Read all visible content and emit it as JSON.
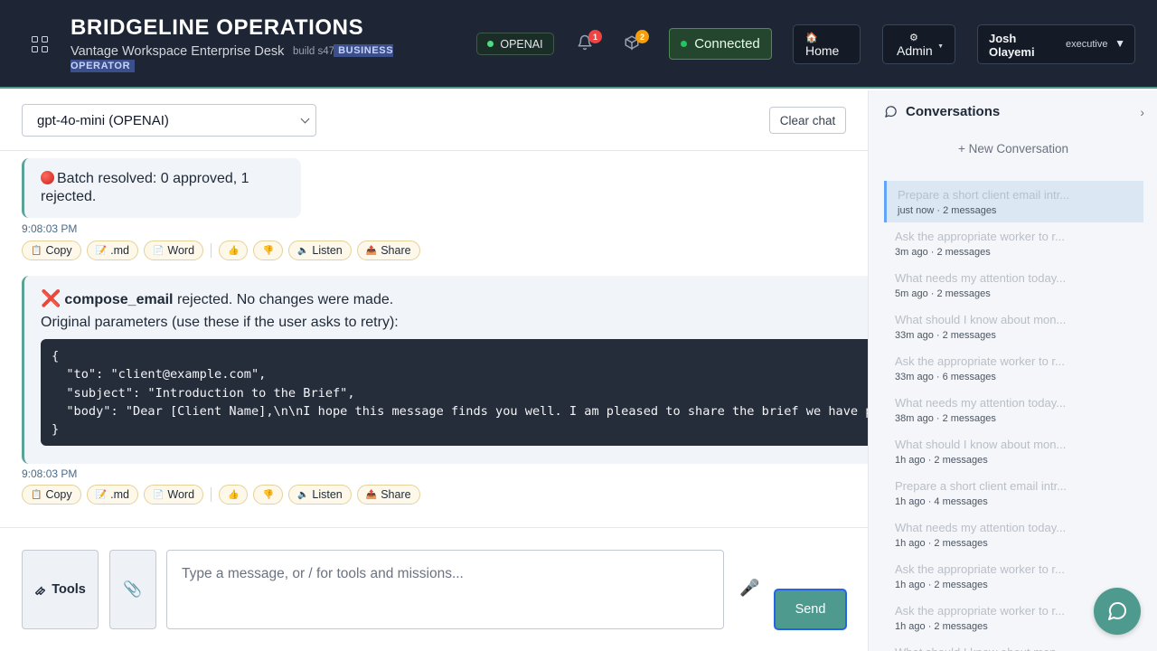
{
  "header": {
    "brand_title": "BRIDGELINE OPERATIONS",
    "brand_subtitle": "Vantage Workspace Enterprise Desk",
    "build": "build s475",
    "role_badge": "BUSINESS OPERATOR",
    "provider": "OPENAI",
    "notifications_count": "1",
    "packages_count": "2",
    "connection_status": "Connected",
    "home_label": "Home",
    "home_icon": "🏠",
    "admin_label": "Admin",
    "admin_icon": "⚙",
    "user_name": "Josh Olayemi",
    "user_role": "executive"
  },
  "toolbar": {
    "model_selected": "gpt-4o-mini (OPENAI)",
    "clear_label": "Clear chat"
  },
  "messages": [
    {
      "text": "Batch resolved: 0 approved, 1 rejected.",
      "time": "9:08:03 PM"
    },
    {
      "tool_name": "compose_email",
      "status_text": "rejected. No changes were made.",
      "params_intro": "Original parameters (use these if the user asks to retry):",
      "code": "{\n  \"to\": \"client@example.com\",\n  \"subject\": \"Introduction to the Brief\",\n  \"body\": \"Dear [Client Name],\\n\\nI hope this message finds you well. I am pleased to share the brief we have pr\n}",
      "time": "9:08:03 PM"
    }
  ],
  "message_actions": {
    "copy": "Copy",
    "md": ".md",
    "word": "Word",
    "like": "👍",
    "dislike": "👎",
    "listen": "Listen",
    "share": "Share"
  },
  "composer": {
    "tools_label": "Tools",
    "placeholder": "Type a message, or / for tools and missions...",
    "send_label": "Send"
  },
  "sidebar": {
    "title": "Conversations",
    "new_label": "+ New Conversation",
    "items": [
      {
        "title": "Prepare a short client email intr...",
        "meta": "just now · 2 messages",
        "active": true
      },
      {
        "title": "Ask the appropriate worker to r...",
        "meta": "3m ago · 2 messages"
      },
      {
        "title": "What needs my attention today...",
        "meta": "5m ago · 2 messages"
      },
      {
        "title": "What should I know about mon...",
        "meta": "33m ago · 2 messages"
      },
      {
        "title": "Ask the appropriate worker to r...",
        "meta": "33m ago · 6 messages"
      },
      {
        "title": "What needs my attention today...",
        "meta": "38m ago · 2 messages"
      },
      {
        "title": "What should I know about mon...",
        "meta": "1h ago · 2 messages"
      },
      {
        "title": "Prepare a short client email intr...",
        "meta": "1h ago · 4 messages"
      },
      {
        "title": "What needs my attention today...",
        "meta": "1h ago · 2 messages"
      },
      {
        "title": "Ask the appropriate worker to r...",
        "meta": "1h ago · 2 messages"
      },
      {
        "title": "Ask the appropriate worker to r...",
        "meta": "1h ago · 2 messages"
      },
      {
        "title": "What should I know about mon...",
        "meta": ""
      }
    ]
  },
  "colors": {
    "header_bg": "#1e2635",
    "accent_teal": "#4e9a8e",
    "connected_green": "#22c55e",
    "reject_red": "#e11d2e",
    "badge_red": "#ef4444",
    "badge_amber": "#f59e0b"
  }
}
